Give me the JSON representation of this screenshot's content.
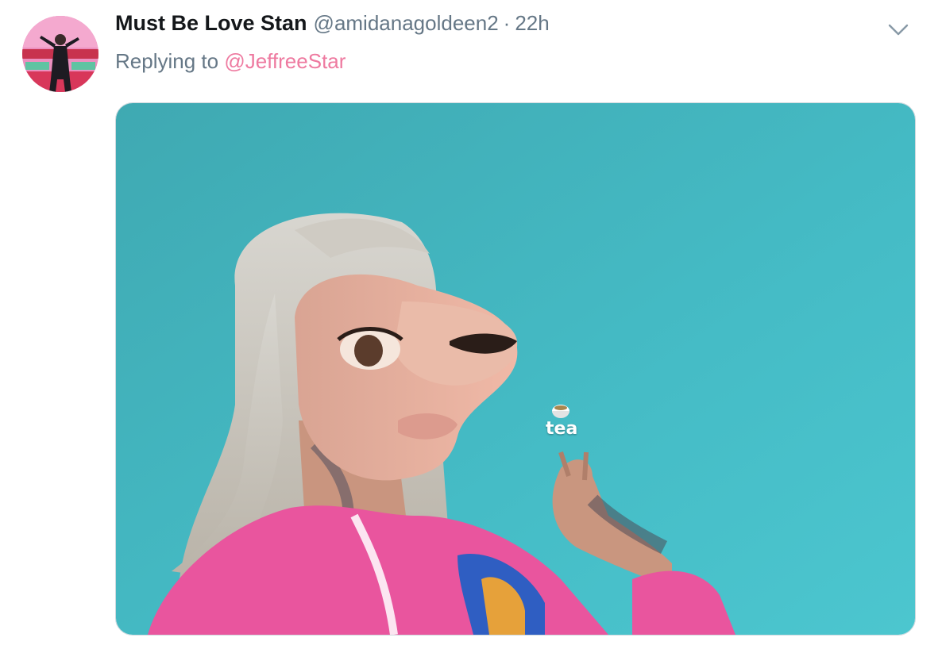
{
  "tweet": {
    "display_name": "Must Be Love Stan",
    "handle": "@amidanagoldeen2",
    "separator": "·",
    "timestamp": "22h",
    "reply_prefix": "Replying to",
    "reply_to": "@JeffreeStar",
    "media": {
      "overlay_text": "tea",
      "overlay_icon": "teacup-icon"
    }
  },
  "icons": {
    "caret": "chevron-down-icon"
  },
  "colors": {
    "name": "#14171a",
    "secondary": "#657786",
    "mention": "#ee7aa0",
    "media_background": "#43b8c2"
  }
}
